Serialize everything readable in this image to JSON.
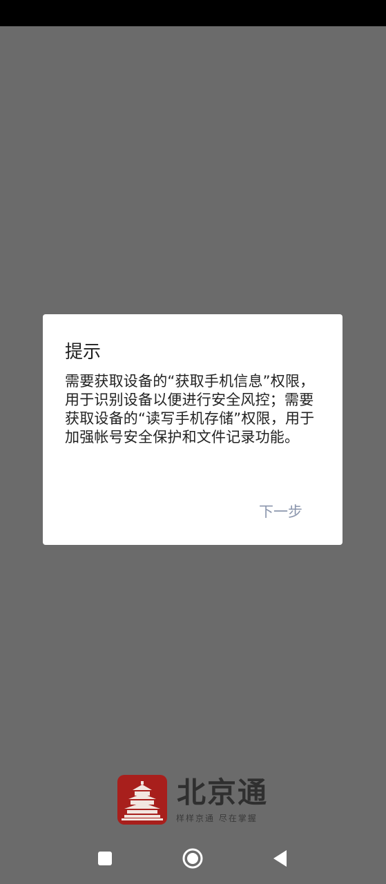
{
  "dialog": {
    "title": "提示",
    "message": "需要获取设备的“获取手机信息”权限，用于识别设备以便进行安全风控；需要获取设备的“读写手机存储”权限，用于加强帐号安全保护和文件记录功能。",
    "next_label": "下一步"
  },
  "brand": {
    "name": "北京通",
    "slogan": "样样京通 尽在掌握",
    "logo_icon": "temple-of-heaven-icon",
    "color": "#a81f1c"
  },
  "nav": {
    "recents_icon": "square-icon",
    "home_icon": "circle-icon",
    "back_icon": "back-triangle-icon"
  },
  "colors": {
    "overlay": "#6b6b6b",
    "status_bar": "#000000",
    "button_text": "#8b96ad"
  }
}
